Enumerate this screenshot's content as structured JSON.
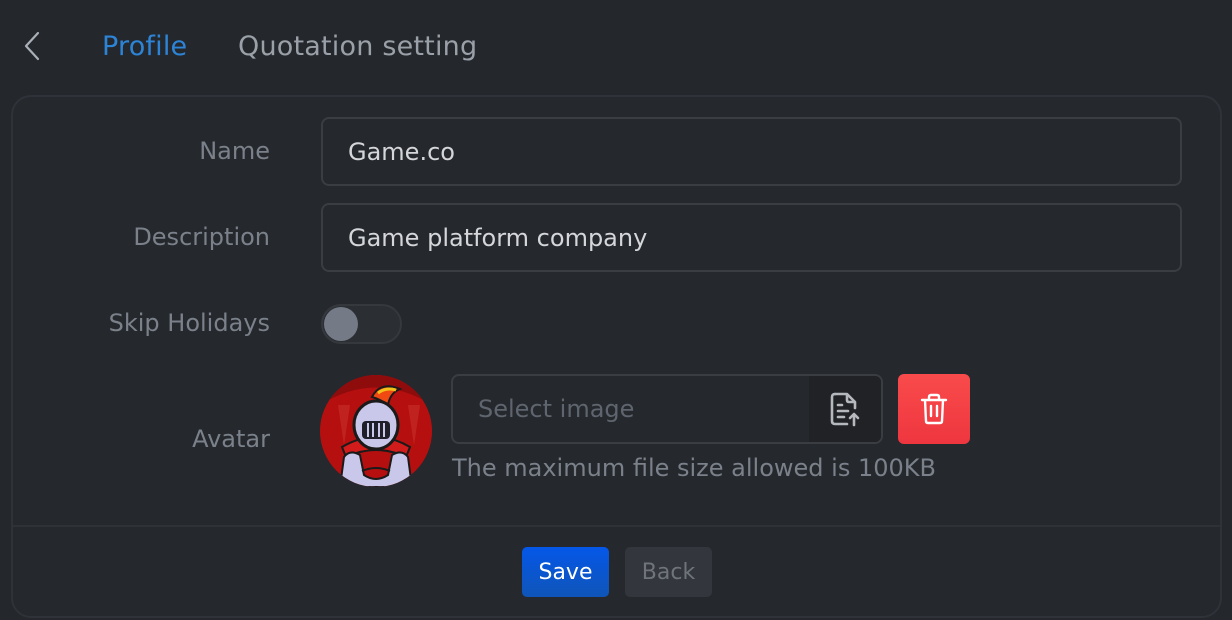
{
  "header": {
    "back_icon": "chevron-left-icon",
    "tabs": [
      {
        "label": "Profile",
        "active": true
      },
      {
        "label": "Quotation setting",
        "active": false
      }
    ]
  },
  "form": {
    "name": {
      "label": "Name",
      "value": "Game.co"
    },
    "description": {
      "label": "Description",
      "value": "Game platform company"
    },
    "skip_holidays": {
      "label": "Skip Holidays",
      "enabled": false
    },
    "avatar": {
      "label": "Avatar",
      "image_alt": "knight mascot logo",
      "file_placeholder": "Select image",
      "upload_icon": "file-upload-icon",
      "delete_icon": "trash-icon",
      "hint": "The maximum file size allowed is 100KB"
    }
  },
  "actions": {
    "save_label": "Save",
    "back_label": "Back"
  },
  "colors": {
    "background": "#24272c",
    "accent": "#2d84d6",
    "primary_button": "#0557e8",
    "danger_button": "#f94b4b"
  }
}
